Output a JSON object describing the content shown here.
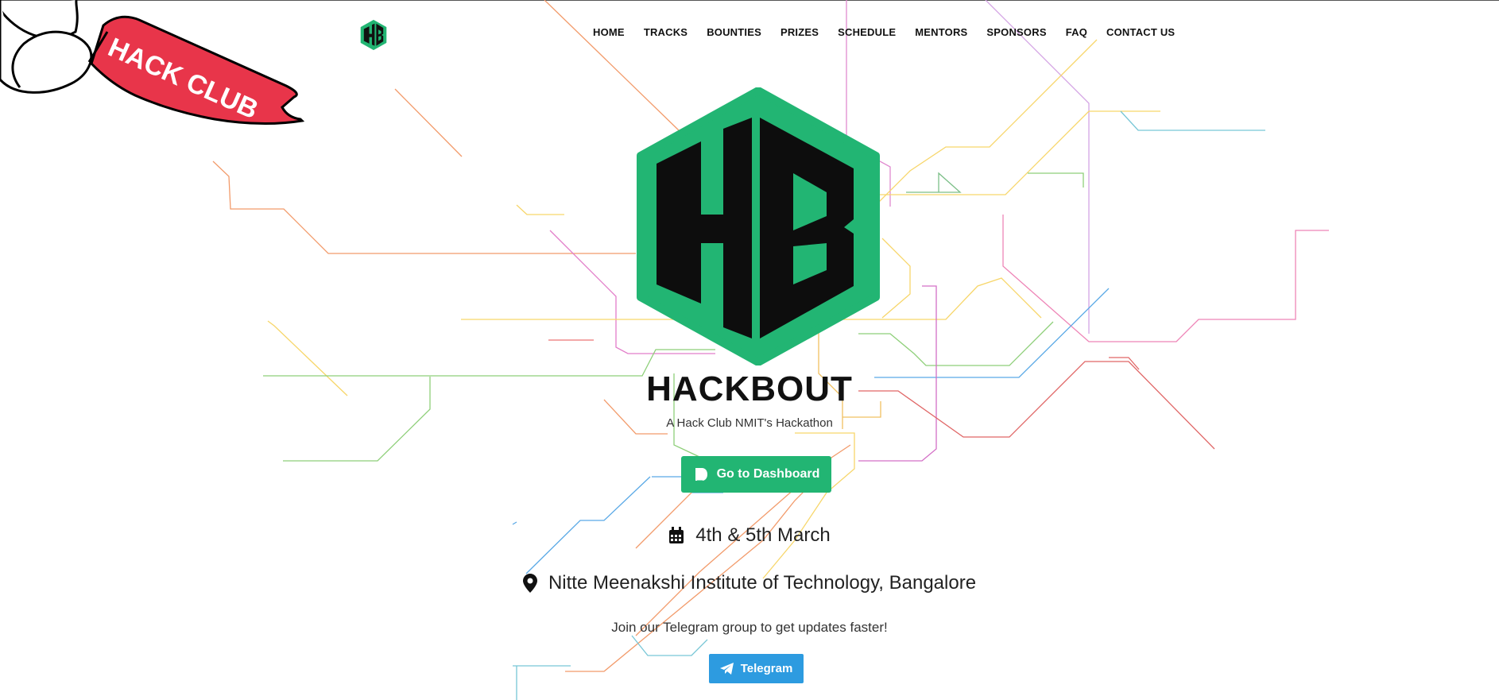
{
  "banner": {
    "text": "HACK CLUB"
  },
  "nav": {
    "items": [
      {
        "label": "HOME"
      },
      {
        "label": "TRACKS"
      },
      {
        "label": "BOUNTIES"
      },
      {
        "label": "PRIZES"
      },
      {
        "label": "SCHEDULE"
      },
      {
        "label": "MENTORS"
      },
      {
        "label": "SPONSORS"
      },
      {
        "label": "FAQ"
      },
      {
        "label": "CONTACT US"
      }
    ]
  },
  "hero": {
    "logo_letters": "HB",
    "title": "HACKBOUT",
    "subtitle": "A Hack Club NMIT's Hackathon",
    "dashboard_button": "Go to Dashboard",
    "date": "4th & 5th March",
    "venue": "Nitte Meenakshi Institute of Technology, Bangalore",
    "join_text": "Join our Telegram group to get updates faster!",
    "telegram_button": "Telegram"
  },
  "colors": {
    "brand_green": "#22b573",
    "telegram_blue": "#2d9be0",
    "banner_red": "#e8354a"
  },
  "icons": {
    "nav_logo": "hb-logo-icon",
    "dashboard": "devfolio-icon",
    "date": "calendar-icon",
    "venue": "map-pin-icon",
    "telegram": "paper-plane-icon"
  }
}
